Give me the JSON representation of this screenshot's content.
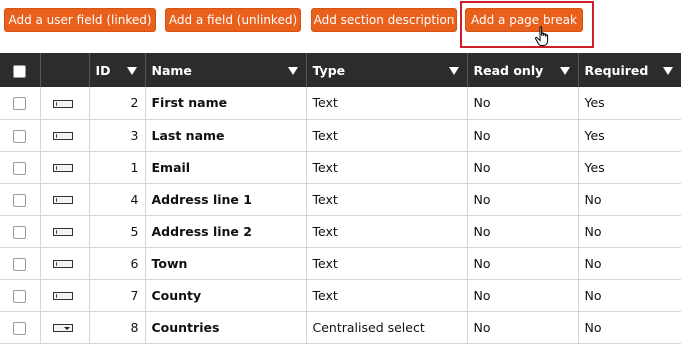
{
  "toolbar": {
    "add_user_field_label": "Add a user field (linked)",
    "add_field_label": "Add a field (unlinked)",
    "add_section_label": "Add section description",
    "add_page_break_label": "Add a page break"
  },
  "colors": {
    "button": "#e8601c",
    "header": "#2c2c2c",
    "highlight_box": "#cc1f2a"
  },
  "table": {
    "headers": {
      "id": "ID",
      "name": "Name",
      "type": "Type",
      "read_only": "Read only",
      "required": "Required"
    },
    "rows": [
      {
        "id": "2",
        "name": "First name",
        "type": "Text",
        "read_only": "No",
        "required": "Yes",
        "icon": "text-field-icon"
      },
      {
        "id": "3",
        "name": "Last name",
        "type": "Text",
        "read_only": "No",
        "required": "Yes",
        "icon": "text-field-icon"
      },
      {
        "id": "1",
        "name": "Email",
        "type": "Text",
        "read_only": "No",
        "required": "Yes",
        "icon": "text-field-icon"
      },
      {
        "id": "4",
        "name": "Address line 1",
        "type": "Text",
        "read_only": "No",
        "required": "No",
        "icon": "text-field-icon"
      },
      {
        "id": "5",
        "name": "Address line 2",
        "type": "Text",
        "read_only": "No",
        "required": "No",
        "icon": "text-field-icon"
      },
      {
        "id": "6",
        "name": "Town",
        "type": "Text",
        "read_only": "No",
        "required": "No",
        "icon": "text-field-icon"
      },
      {
        "id": "7",
        "name": "County",
        "type": "Text",
        "read_only": "No",
        "required": "No",
        "icon": "text-field-icon"
      },
      {
        "id": "8",
        "name": "Countries",
        "type": "Centralised select",
        "read_only": "No",
        "required": "No",
        "icon": "select-field-icon"
      }
    ]
  }
}
